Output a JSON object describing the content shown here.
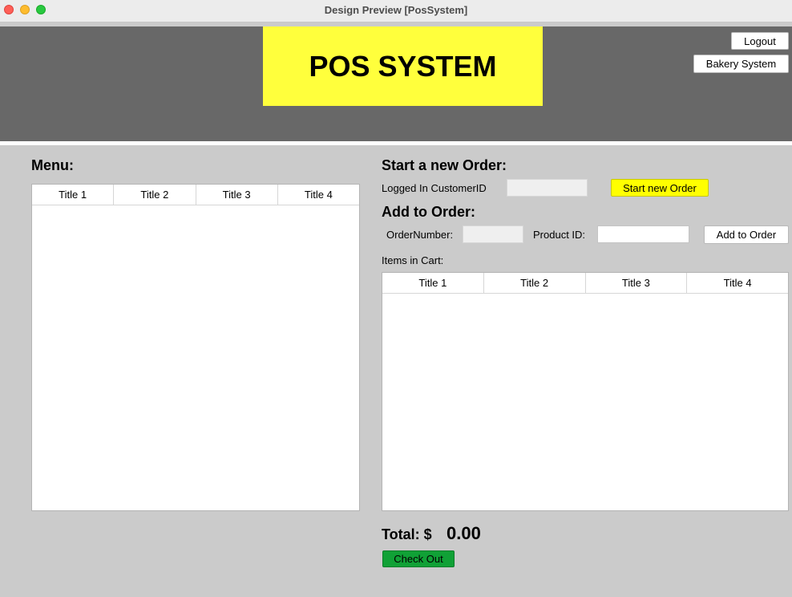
{
  "window": {
    "title": "Design Preview [PosSystem]"
  },
  "header": {
    "banner_title": "POS SYSTEM",
    "logout_label": "Logout",
    "bakery_label": "Bakery System",
    "banner_color": "#ffff3c"
  },
  "menu": {
    "label": "Menu:",
    "columns": [
      "Title 1",
      "Title 2",
      "Title 3",
      "Title 4"
    ]
  },
  "new_order": {
    "heading": "Start a new Order:",
    "customer_label": "Logged In CustomerID",
    "customer_value": "",
    "start_button": "Start new Order"
  },
  "add_order": {
    "heading": "Add to Order:",
    "order_number_label": "OrderNumber:",
    "order_number_value": "",
    "product_label": "Product ID:",
    "product_value": "",
    "add_button": "Add to Order"
  },
  "cart": {
    "label": "Items in Cart:",
    "columns": [
      "Title 1",
      "Title 2",
      "Title 3",
      "Title 4"
    ]
  },
  "total": {
    "label": "Total: $",
    "value": "0.00"
  },
  "checkout": {
    "label": "Check Out",
    "color": "#10a136"
  }
}
